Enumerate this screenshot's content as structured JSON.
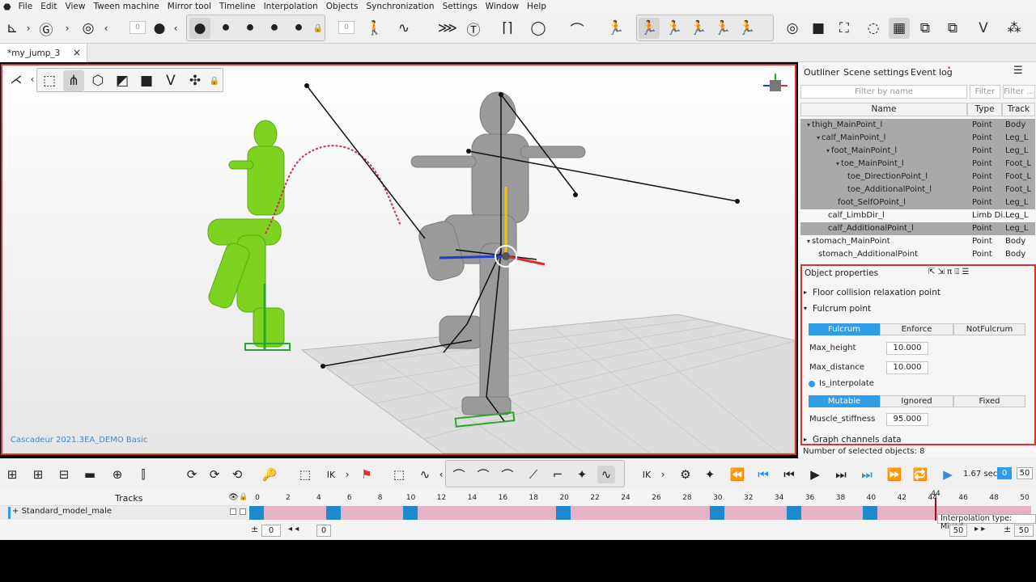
{
  "menu": [
    "File",
    "Edit",
    "View",
    "Tween machine",
    "Mirror tool",
    "Timeline",
    "Interpolation",
    "Objects",
    "Synchronization",
    "Settings",
    "Window",
    "Help"
  ],
  "toolbar": {
    "spin_left": "0",
    "spin_right": "0"
  },
  "tab": {
    "title": "*my_jump_3",
    "close": "×"
  },
  "viewport": {
    "watermark": "Cascadeur 2021.3EA_DEMO Basic"
  },
  "right_tabs": [
    "Outliner",
    "Scene settings",
    "Event log"
  ],
  "filters": {
    "name": "Filter by name",
    "type": "Filter ...",
    "track": "Filter ..."
  },
  "outliner": {
    "headers": {
      "name": "Name",
      "type": "Type",
      "track": "Track"
    },
    "rows": [
      {
        "name": "thigh_MainPoint_l",
        "type": "Point",
        "track": "Body",
        "indent": 0,
        "arrow": "▾",
        "hl": true
      },
      {
        "name": "calf_MainPoint_l",
        "type": "Point",
        "track": "Leg_L",
        "indent": 1,
        "arrow": "▾",
        "hl": true
      },
      {
        "name": "foot_MainPoint_l",
        "type": "Point",
        "track": "Leg_L",
        "indent": 2,
        "arrow": "▾",
        "hl": true
      },
      {
        "name": "toe_MainPoint_l",
        "type": "Point",
        "track": "Foot_L",
        "indent": 3,
        "arrow": "▾",
        "hl": true
      },
      {
        "name": "toe_DirectionPoint_l",
        "type": "Point",
        "track": "Foot_L",
        "indent": 4,
        "arrow": "",
        "hl": true
      },
      {
        "name": "toe_AdditionalPoint_l",
        "type": "Point",
        "track": "Foot_L",
        "indent": 4,
        "arrow": "",
        "hl": true
      },
      {
        "name": "foot_SelfOPoint_l",
        "type": "Point",
        "track": "Leg_L",
        "indent": 3,
        "arrow": "",
        "hl": true
      },
      {
        "name": "calf_LimbDir_l",
        "type": "Limb Di...",
        "track": "Leg_L",
        "indent": 2,
        "arrow": "",
        "hl": false
      },
      {
        "name": "calf_AdditionalPoint_l",
        "type": "Point",
        "track": "Leg_L",
        "indent": 2,
        "arrow": "",
        "hl": true
      },
      {
        "name": "stomach_MainPoint",
        "type": "Point",
        "track": "Body",
        "indent": 0,
        "arrow": "▾",
        "hl": false
      },
      {
        "name": "stomach_AdditionalPoint",
        "type": "Point",
        "track": "Body",
        "indent": 1,
        "arrow": "",
        "hl": false
      }
    ]
  },
  "props": {
    "title": "Object properties",
    "sec1": "Floor collision relaxation point",
    "sec2": "Fulcrum point",
    "fulcrum_opts": [
      "Fulcrum",
      "Enforce",
      "NotFulcrum"
    ],
    "max_height_label": "Max_height",
    "max_height": "10.000",
    "max_distance_label": "Max_distance",
    "max_distance": "10.000",
    "is_interp": "Is_interpolate",
    "mut_opts": [
      "Mutable",
      "Ignored",
      "Fixed"
    ],
    "muscle_label": "Muscle_stiffness",
    "muscle": "95.000",
    "sec3": "Graph channels data"
  },
  "selected_count": "Number of selected objects: 8",
  "playback": {
    "fps": "1.67 sec",
    "frame_a": "0",
    "frame_b": "50"
  },
  "timeline": {
    "tracks_label": "Tracks",
    "track_name": "Standard_model_male",
    "ticks": [
      "0",
      "2",
      "4",
      "6",
      "8",
      "10",
      "12",
      "14",
      "16",
      "18",
      "20",
      "22",
      "24",
      "26",
      "28",
      "30",
      "32",
      "34",
      "36",
      "38",
      "40",
      "42",
      "44",
      "46",
      "48",
      "50"
    ],
    "current_frame": "44",
    "keyframes": [
      0,
      5,
      10,
      20,
      30,
      35,
      40
    ],
    "tooltip": "Interpolation type: Mixed",
    "range_start": "0",
    "range_cur": "0",
    "range_end": "50",
    "range_end2": "50"
  },
  "colors": {
    "accent": "#2f9de8",
    "highlight": "#e0302f",
    "green_model": "#7ed321",
    "grey_model": "#9a9a9a"
  }
}
